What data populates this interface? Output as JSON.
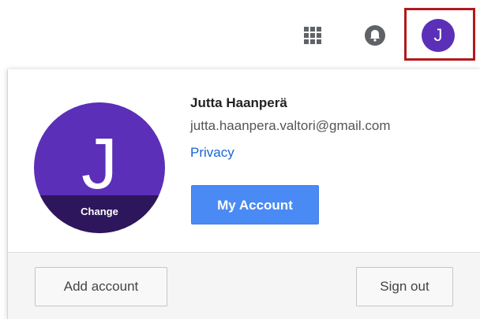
{
  "header": {
    "apps_icon": "apps-grid-icon",
    "notifications_icon": "bell-icon",
    "avatar_letter": "J",
    "highlight_color": "#b3191d",
    "avatar_color": "#5b2fb8"
  },
  "account_card": {
    "avatar_letter": "J",
    "change_label": "Change",
    "name": "Jutta Haanperä",
    "email": "jutta.haanpera.valtori@gmail.com",
    "privacy_label": "Privacy",
    "my_account_label": "My Account",
    "add_account_label": "Add account",
    "sign_out_label": "Sign out",
    "accent_color": "#4a8af4",
    "link_color": "#1a63d6"
  }
}
